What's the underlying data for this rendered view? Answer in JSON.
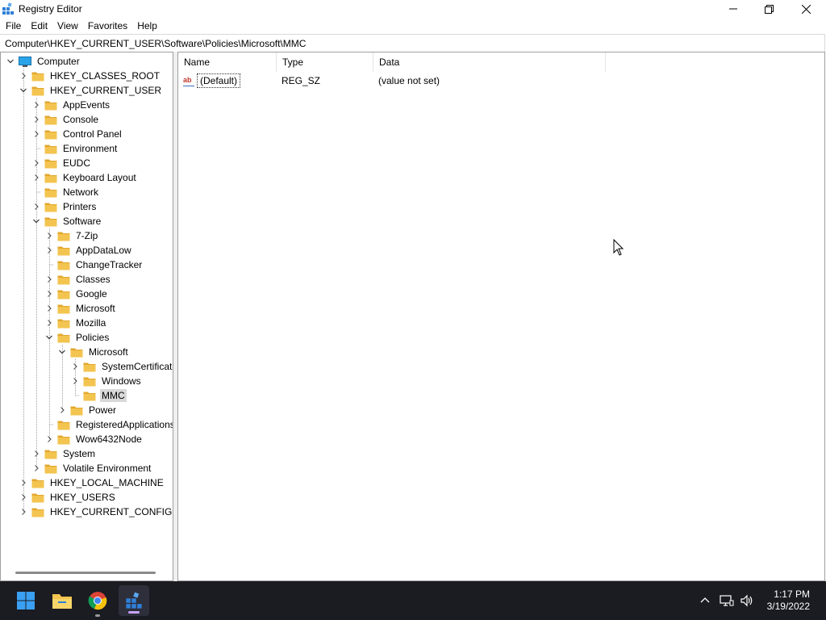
{
  "window": {
    "title": "Registry Editor",
    "minimize_label": "minimize",
    "maximize_label": "restore",
    "close_label": "close"
  },
  "menu": [
    "File",
    "Edit",
    "View",
    "Favorites",
    "Help"
  ],
  "address": {
    "path": "Computer\\HKEY_CURRENT_USER\\Software\\Policies\\Microsoft\\MMC"
  },
  "tree": [
    {
      "label": "Computer",
      "depth": 0,
      "state": "expanded",
      "icon": "computer-icon"
    },
    {
      "label": "HKEY_CLASSES_ROOT",
      "depth": 1,
      "state": "collapsed"
    },
    {
      "label": "HKEY_CURRENT_USER",
      "depth": 1,
      "state": "expanded"
    },
    {
      "label": "AppEvents",
      "depth": 2,
      "state": "collapsed"
    },
    {
      "label": "Console",
      "depth": 2,
      "state": "collapsed"
    },
    {
      "label": "Control Panel",
      "depth": 2,
      "state": "collapsed"
    },
    {
      "label": "Environment",
      "depth": 2,
      "state": "leaf"
    },
    {
      "label": "EUDC",
      "depth": 2,
      "state": "collapsed"
    },
    {
      "label": "Keyboard Layout",
      "depth": 2,
      "state": "collapsed"
    },
    {
      "label": "Network",
      "depth": 2,
      "state": "leaf"
    },
    {
      "label": "Printers",
      "depth": 2,
      "state": "collapsed"
    },
    {
      "label": "Software",
      "depth": 2,
      "state": "expanded"
    },
    {
      "label": "7-Zip",
      "depth": 3,
      "state": "collapsed"
    },
    {
      "label": "AppDataLow",
      "depth": 3,
      "state": "collapsed"
    },
    {
      "label": "ChangeTracker",
      "depth": 3,
      "state": "leaf"
    },
    {
      "label": "Classes",
      "depth": 3,
      "state": "collapsed"
    },
    {
      "label": "Google",
      "depth": 3,
      "state": "collapsed"
    },
    {
      "label": "Microsoft",
      "depth": 3,
      "state": "collapsed"
    },
    {
      "label": "Mozilla",
      "depth": 3,
      "state": "collapsed"
    },
    {
      "label": "Policies",
      "depth": 3,
      "state": "expanded"
    },
    {
      "label": "Microsoft",
      "depth": 4,
      "state": "expanded"
    },
    {
      "label": "SystemCertificates",
      "depth": 5,
      "state": "collapsed"
    },
    {
      "label": "Windows",
      "depth": 5,
      "state": "collapsed"
    },
    {
      "label": "MMC",
      "depth": 5,
      "state": "leaf",
      "selected": true
    },
    {
      "label": "Power",
      "depth": 4,
      "state": "collapsed"
    },
    {
      "label": "RegisteredApplications",
      "depth": 3,
      "state": "leaf"
    },
    {
      "label": "Wow6432Node",
      "depth": 3,
      "state": "collapsed"
    },
    {
      "label": "System",
      "depth": 2,
      "state": "collapsed"
    },
    {
      "label": "Volatile Environment",
      "depth": 2,
      "state": "collapsed"
    },
    {
      "label": "HKEY_LOCAL_MACHINE",
      "depth": 1,
      "state": "collapsed"
    },
    {
      "label": "HKEY_USERS",
      "depth": 1,
      "state": "collapsed"
    },
    {
      "label": "HKEY_CURRENT_CONFIG",
      "depth": 1,
      "state": "collapsed"
    }
  ],
  "list": {
    "columns": [
      "Name",
      "Type",
      "Data"
    ],
    "rows": [
      {
        "name": "(Default)",
        "type": "REG_SZ",
        "data": "(value not set)",
        "icon": "string-value-icon"
      }
    ]
  },
  "taskbar": {
    "apps": [
      "start-icon",
      "file-explorer-icon",
      "chrome-icon",
      "registry-editor-icon"
    ],
    "time": "1:17 PM",
    "date": "3/19/2022"
  },
  "colors": {
    "folder": "#f3c44f",
    "folder_dark": "#e2a72e",
    "selection": "#d9d9d9",
    "taskbar": "#1b1b22",
    "accent": "#0078d4"
  }
}
